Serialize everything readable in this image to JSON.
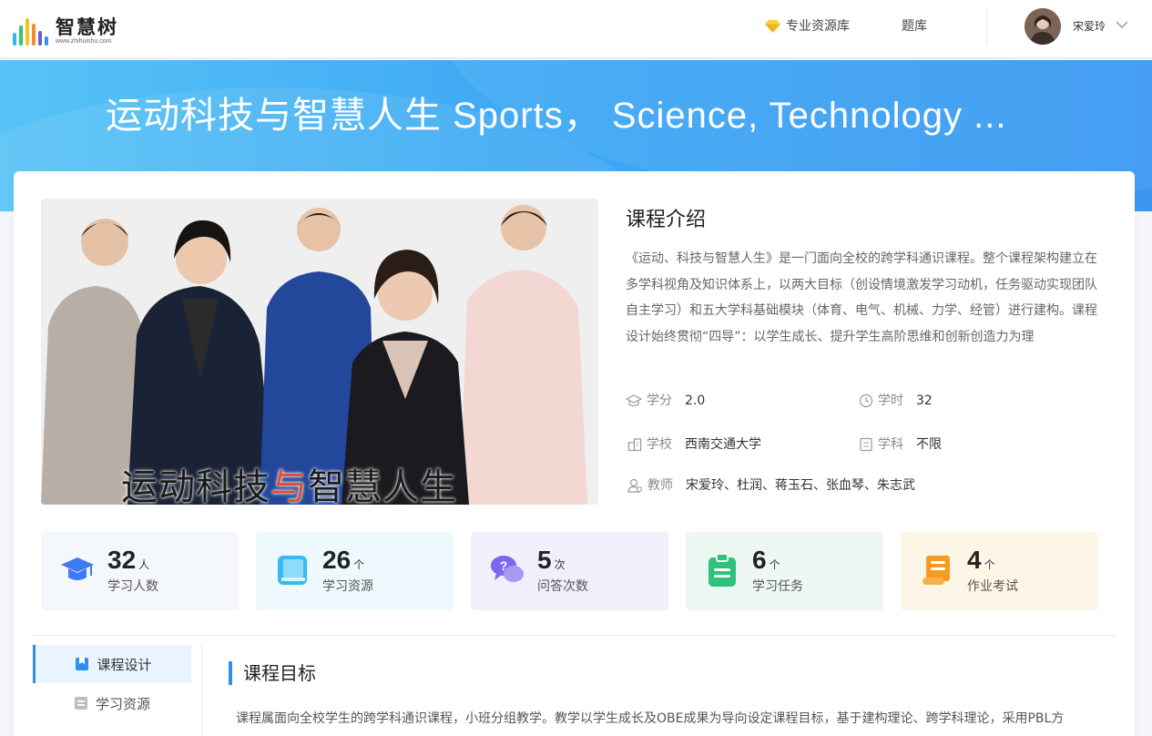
{
  "header": {
    "logo_text": "智慧树",
    "logo_url": "www.zhihuishu.com",
    "nav": {
      "resource_lib": "专业资源库",
      "question_bank": "题库"
    },
    "user_name": "宋爱玲"
  },
  "banner": {
    "title": "运动科技与智慧人生 Sports， Science, Technology ..."
  },
  "cover": {
    "caption_a": "运动科技",
    "caption_b": "与",
    "caption_c": "智慧人生"
  },
  "intro": {
    "title": "课程介绍",
    "text": "《运动、科技与智慧人生》是一门面向全校的跨学科通识课程。整个课程架构建立在多学科视角及知识体系上，以两大目标（创设情境激发学习动机，任务驱动实现团队自主学习）和五大学科基础模块（体育、电气、机械、力学、经管）进行建构。课程设计始终贯彻“四导”：以学生成长、提升学生高阶思维和创新创造力为理"
  },
  "meta": {
    "credit": {
      "label": "学分",
      "value": "2.0"
    },
    "hours": {
      "label": "学时",
      "value": "32"
    },
    "school": {
      "label": "学校",
      "value": "西南交通大学"
    },
    "subject": {
      "label": "学科",
      "value": "不限"
    },
    "teacher": {
      "label": "教师",
      "value": "宋爱玲、杜润、蒋玉石、张血琴、朱志武"
    }
  },
  "stats": [
    {
      "num": "32",
      "unit": "人",
      "label": "学习人数",
      "bg": "#f4f8fd",
      "icon": "graduation-cap-icon",
      "color": "#3d7bf2"
    },
    {
      "num": "26",
      "unit": "个",
      "label": "学习资源",
      "bg": "#eef9fd",
      "icon": "book-icon",
      "color": "#39b9ef"
    },
    {
      "num": "5",
      "unit": "次",
      "label": "问答次数",
      "bg": "#f1effc",
      "icon": "chat-question-icon",
      "color": "#7b68ee"
    },
    {
      "num": "6",
      "unit": "个",
      "label": "学习任务",
      "bg": "#eef8f2",
      "icon": "clipboard-icon",
      "color": "#2fc27c"
    },
    {
      "num": "4",
      "unit": "个",
      "label": "作业考试",
      "bg": "#fdf6e6",
      "icon": "scroll-icon",
      "color": "#f59b22"
    }
  ],
  "sidebar": {
    "items": [
      {
        "label": "课程设计"
      },
      {
        "label": "学习资源"
      }
    ]
  },
  "section": {
    "title": "课程目标",
    "text": "课程属面向全校学生的跨学科通识课程，小班分组教学。教学以学生成长及OBE成果为导向设定课程目标，基于建构理论、跨学科理论，采用PBL方"
  }
}
